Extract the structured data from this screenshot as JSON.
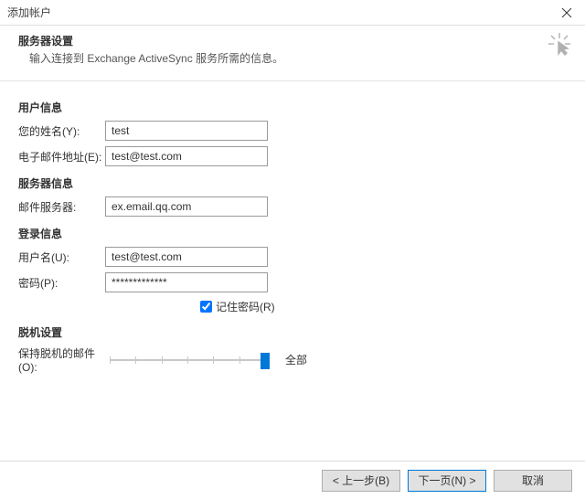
{
  "window": {
    "title": "添加帐户"
  },
  "header": {
    "title": "服务器设置",
    "subtitle": "输入连接到 Exchange ActiveSync 服务所需的信息。"
  },
  "sections": {
    "user_info": {
      "title": "用户信息",
      "name_label": "您的姓名(Y):",
      "name_value": "test",
      "email_label": "电子邮件地址(E):",
      "email_value": "test@test.com"
    },
    "server_info": {
      "title": "服务器信息",
      "server_label": "邮件服务器:",
      "server_value": "ex.email.qq.com"
    },
    "login_info": {
      "title": "登录信息",
      "user_label": "用户名(U):",
      "user_value": "test@test.com",
      "password_label": "密码(P):",
      "password_value": "*************",
      "remember_label": "记住密码(R)"
    },
    "offline": {
      "title": "脱机设置",
      "keep_label": "保持脱机的邮件(O):",
      "slider_value": "全部"
    }
  },
  "footer": {
    "back": "< 上一步(B)",
    "next": "下一页(N) >",
    "cancel": "取消"
  }
}
